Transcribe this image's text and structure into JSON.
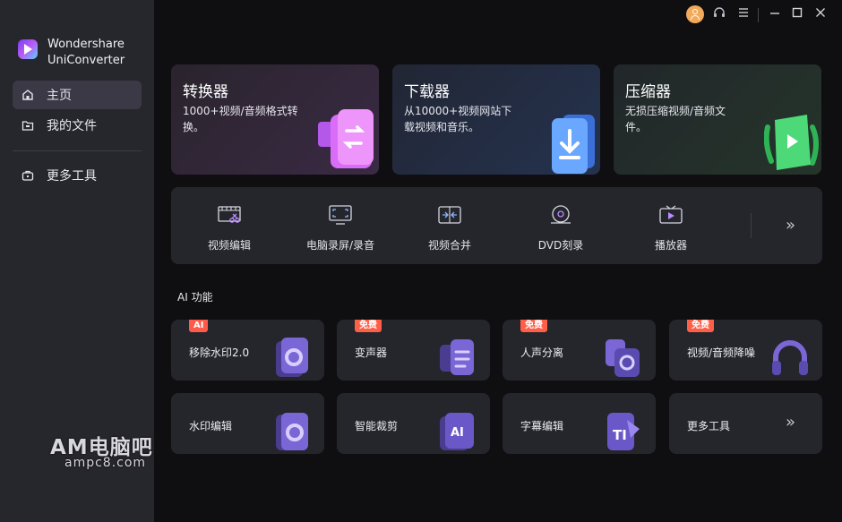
{
  "app": {
    "brand_line1": "Wondershare",
    "brand_line2": "UniConverter"
  },
  "sidebar": {
    "items": [
      {
        "label": "主页",
        "icon": "home-icon",
        "active": true
      },
      {
        "label": "我的文件",
        "icon": "folder-icon",
        "active": false
      },
      {
        "label": "更多工具",
        "icon": "toolbox-icon",
        "active": false
      }
    ]
  },
  "titlebar": {
    "icons": [
      "avatar-icon",
      "headset-icon",
      "menu-icon",
      "minimize-icon",
      "maximize-icon",
      "close-icon"
    ]
  },
  "feature_cards": [
    {
      "title": "转换器",
      "desc": "1000+视频/音频格式转换。",
      "color": "#c561f5"
    },
    {
      "title": "下载器",
      "desc": "从10000+视频网站下载视频和音乐。",
      "color": "#4e8cf7"
    },
    {
      "title": "压缩器",
      "desc": "无损压缩视频/音频文件。",
      "color": "#40d66a"
    }
  ],
  "tools": [
    {
      "label": "视频编辑",
      "icon": "video-edit-icon"
    },
    {
      "label": "电脑录屏/录音",
      "icon": "screen-record-icon"
    },
    {
      "label": "视频合并",
      "icon": "merge-icon"
    },
    {
      "label": "DVD刻录",
      "icon": "dvd-icon"
    },
    {
      "label": "播放器",
      "icon": "player-icon"
    }
  ],
  "tools_more": "»",
  "ai_section": {
    "title": "AI 功能",
    "items": [
      {
        "label": "移除水印2.0",
        "badge": "AI"
      },
      {
        "label": "变声器",
        "badge": "免费"
      },
      {
        "label": "人声分离",
        "badge": "免费"
      },
      {
        "label": "视频/音频降噪",
        "badge": "免费"
      },
      {
        "label": "水印编辑",
        "badge": ""
      },
      {
        "label": "智能裁剪",
        "badge": ""
      },
      {
        "label": "字幕编辑",
        "badge": ""
      },
      {
        "label": "更多工具",
        "badge": ""
      }
    ],
    "more_arrow": "»"
  },
  "watermark": {
    "line1": "AM电脑吧",
    "line2": "ampc8.com"
  }
}
